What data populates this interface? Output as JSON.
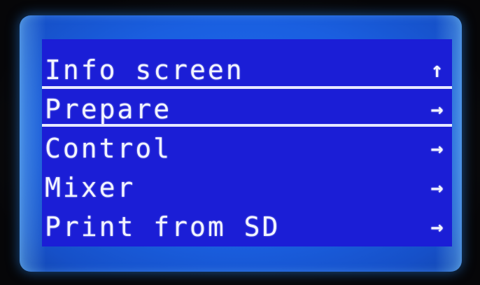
{
  "menu": {
    "items": [
      {
        "label": "Info screen",
        "icon": "up-arrow-icon",
        "glyph": "↑"
      },
      {
        "label": "Prepare",
        "icon": "right-arrow-icon",
        "glyph": "→"
      },
      {
        "label": "Control",
        "icon": "right-arrow-icon",
        "glyph": "→"
      },
      {
        "label": "Mixer",
        "icon": "right-arrow-icon",
        "glyph": "→"
      },
      {
        "label": "Print from SD",
        "icon": "right-arrow-icon",
        "glyph": "→"
      }
    ],
    "selected_index": 1
  },
  "colors": {
    "panel": "#1b1ed6",
    "text": "#f2f4ff",
    "backlight": "#1f6ff0"
  }
}
